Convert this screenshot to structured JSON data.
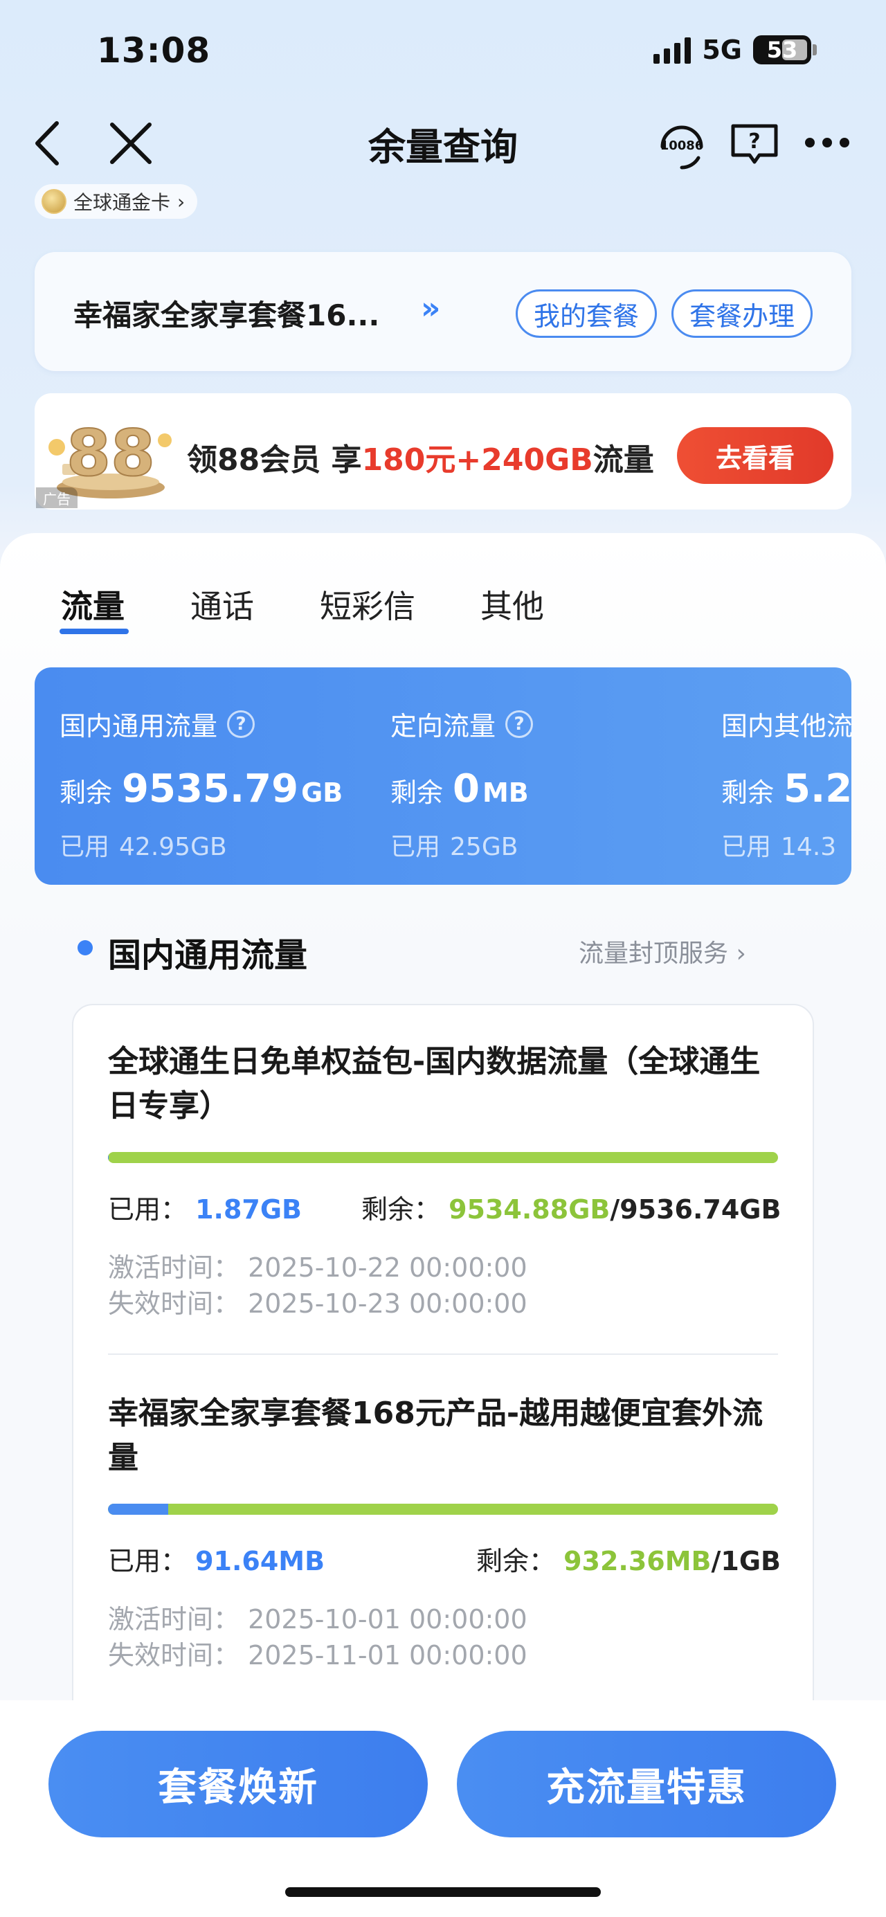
{
  "status": {
    "time": "13:08",
    "network": "5G",
    "battery": "53"
  },
  "nav": {
    "title": "余量查询",
    "service_number": "10086"
  },
  "card_chip": {
    "label": "全球通金卡"
  },
  "plan": {
    "name": "幸福家全家享套餐16...",
    "my_plan_label": "我的套餐",
    "handle_label": "套餐办理"
  },
  "ad": {
    "text_prefix": "领88会员 享",
    "text_highlight": "180元+240GB",
    "text_suffix": "流量",
    "button_label": "去看看",
    "tag": "广告",
    "badge": "88"
  },
  "tabs": [
    {
      "label": "流量",
      "active": true
    },
    {
      "label": "通话",
      "active": false
    },
    {
      "label": "短彩信",
      "active": false
    },
    {
      "label": "其他",
      "active": false
    }
  ],
  "summary": [
    {
      "title": "国内通用流量",
      "remain_label": "剩余",
      "remain_value": "9535.79",
      "remain_unit": "GB",
      "used_label": "已用",
      "used_value": "42.95GB",
      "help": true
    },
    {
      "title": "定向流量",
      "remain_label": "剩余",
      "remain_value": "0",
      "remain_unit": "MB",
      "used_label": "已用",
      "used_value": "25GB",
      "help": true
    },
    {
      "title": "国内其他流",
      "remain_label": "剩余",
      "remain_value": "5.2",
      "remain_unit": "",
      "used_label": "已用",
      "used_value": "14.3",
      "help": false
    }
  ],
  "section": {
    "title": "国内通用流量",
    "link": "流量封顶服务 ›"
  },
  "items": [
    {
      "title": "全球通生日免单权益包-国内数据流量（全球通生日专享）",
      "used_label": "已用：",
      "used": "1.87GB",
      "remain_label": "剩余：",
      "remain": "9534.88GB",
      "total": "/9536.74GB",
      "used_fraction": 0.0002,
      "activate": "激活时间：  2025-10-22 00:00:00",
      "expire": "失效时间：  2025-10-23 00:00:00"
    },
    {
      "title": "幸福家全家享套餐168元产品-越用越便宜套外流量",
      "used_label": "已用：",
      "used": "91.64MB",
      "remain_label": "剩余：",
      "remain": "932.36MB",
      "total": "/1GB",
      "used_fraction": 0.0895,
      "activate": "激活时间：  2025-10-01 00:00:00",
      "expire": "失效时间：  2025-11-01 00:00:00"
    }
  ],
  "bottom": {
    "renew_label": "套餐焕新",
    "recharge_label": "充流量特惠"
  },
  "colors": {
    "accent": "#3B82F6",
    "remain_green": "#8CC43A",
    "ad_red": "#E83B2C"
  }
}
